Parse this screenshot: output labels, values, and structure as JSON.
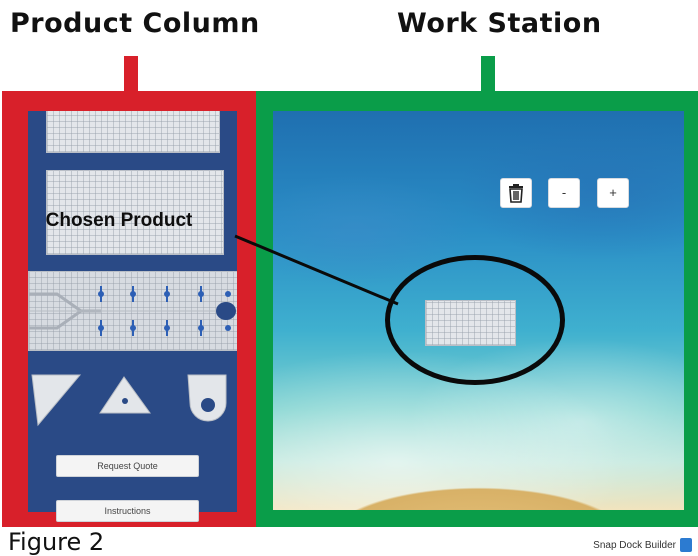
{
  "headers": {
    "product_column": "Product Column",
    "work_station": "Work Station"
  },
  "product_column": {
    "chosen_product_label": "Chosen Product",
    "buttons": {
      "request_quote": "Request Quote",
      "instructions": "Instructions"
    }
  },
  "work_station": {
    "toolbar": {
      "delete_icon": "trash-icon",
      "zoom_out_label": "-",
      "zoom_in_label": "+"
    }
  },
  "footer": {
    "figure_label": "Figure 2",
    "brand_label": "Snap Dock Builder"
  },
  "colors": {
    "product_frame": "#d8202a",
    "work_frame": "#0a9d49",
    "product_bg": "#2a4a86"
  }
}
